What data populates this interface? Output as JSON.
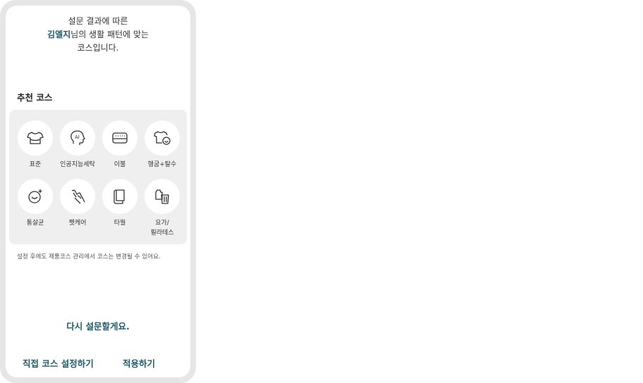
{
  "intro": {
    "line1": "설문 결과에 따른",
    "user_name": "김엘지",
    "line2_suffix": "님의 생활 패턴에 맞는",
    "line3": "코스입니다."
  },
  "recommended": {
    "title": "추천 코스",
    "courses": [
      {
        "label": "표준",
        "icon": "shirt-icon"
      },
      {
        "label": "인공지능세탁",
        "icon": "ai-head-icon"
      },
      {
        "label": "이불",
        "icon": "blanket-icon"
      },
      {
        "label": "헹굼+탈수",
        "icon": "shirt-spin-icon"
      },
      {
        "label": "통살균",
        "icon": "tub-sparkle-icon"
      },
      {
        "label": "펫케어",
        "icon": "pet-hand-icon"
      },
      {
        "label": "타월",
        "icon": "towel-icon"
      },
      {
        "label": "요가/\n필라테스",
        "icon": "yoga-wear-icon"
      }
    ]
  },
  "note": "설정 후에도 제품코스 관리에서 코스는 변경될 수 있어요.",
  "actions": {
    "retry": "다시 설문할게요.",
    "manual": "직접 코스 설정하기",
    "apply": "적용하기"
  },
  "colors": {
    "accent": "#1f5c6b",
    "panel": "#efefef"
  }
}
